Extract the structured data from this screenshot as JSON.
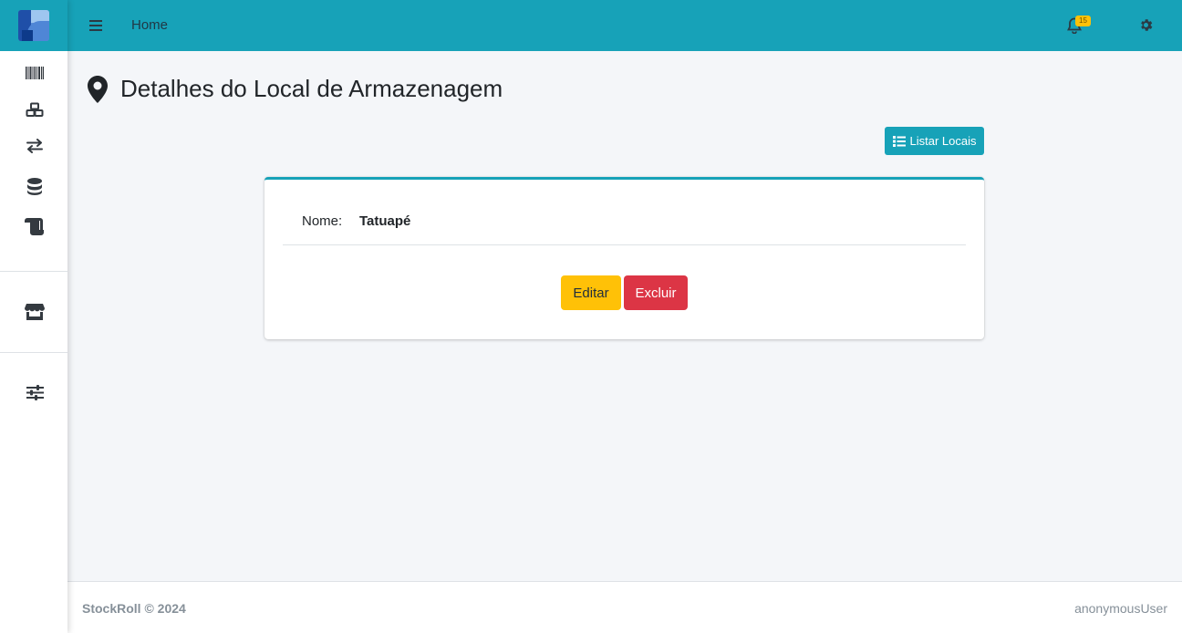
{
  "topbar": {
    "home_label": "Home",
    "notification_count": "15"
  },
  "sidebar": {
    "items": [
      {
        "icon": "barcode-icon"
      },
      {
        "icon": "cubes-icon"
      },
      {
        "icon": "exchange-icon"
      },
      {
        "icon": "database-icon"
      },
      {
        "icon": "scroll-icon"
      },
      {
        "icon": "store-icon"
      },
      {
        "icon": "sliders-icon"
      }
    ]
  },
  "page": {
    "title": "Detalhes do Local de Armazenagem",
    "list_button_label": "Listar Locais"
  },
  "detail": {
    "name_label": "Nome:",
    "name_value": "Tatuapé"
  },
  "actions": {
    "edit_label": "Editar",
    "delete_label": "Excluir"
  },
  "footer": {
    "left": "StockRoll © 2024",
    "right": "anonymousUser"
  },
  "colors": {
    "primary": "#17a2b8",
    "warning": "#ffc107",
    "danger": "#dc3545",
    "background": "#f4f6f9"
  }
}
